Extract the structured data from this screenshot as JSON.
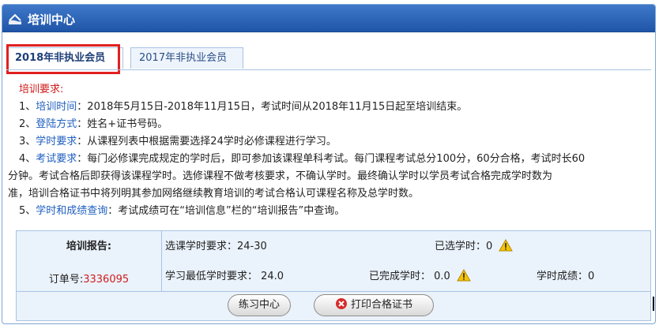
{
  "window": {
    "title": "培训中心"
  },
  "tabs": [
    {
      "label": "2018年非执业会员",
      "active": true
    },
    {
      "label": "2017年非执业会员",
      "active": false
    }
  ],
  "requirements": {
    "heading": "培训要求:",
    "items": [
      {
        "prefix": "1、",
        "key": "培训时间",
        "text": "：2018年5月15日-2018年11月15日，考试时间从2018年11月15日起至培训结束。"
      },
      {
        "prefix": "2、",
        "key": "登陆方式",
        "text": "：姓名+证书号码。"
      },
      {
        "prefix": "3、",
        "key": "学时要求",
        "text": "：从课程列表中根据需要选择24学时必修课程进行学习。"
      },
      {
        "prefix": "4、",
        "key": "考试要求",
        "text": "：每门必修课完成规定的学时后，即可参加该课程单科考试。每门课程考试总分100分，60分合格，考试时长60",
        "cont1": "分钟。考试合格后即获得该课程学时。选修课程不做考核要求，不确认学时。最终确认学时以学员考试合格完成学时数为",
        "cont2": "准，培训合格证书中将列明其参加网络继续教育培训的考试合格认可课程名称及总学时数。"
      },
      {
        "prefix": "5、",
        "key": "学时和成绩查询",
        "text": "：考试成绩可在“培训信息”栏的“培训报告”中查询。"
      }
    ]
  },
  "report": {
    "heading": "培训报告:",
    "order_label": "订单号:",
    "order_number": "3336095",
    "required_hours": "选课学时要求：24-30",
    "selected_hours": "已选学时：0",
    "min_hours": "学习最低学时要求： 24.0",
    "completed_hours": "已完成学时： 0.0",
    "score": "学时成绩：0"
  },
  "buttons": {
    "practice": "练习中心",
    "print": "打印合格证书"
  },
  "colors": {
    "accent": "#1f5fbf",
    "red": "#d11c1c",
    "title_bar": "#2a63b5",
    "highlight_box": "#e02020"
  }
}
